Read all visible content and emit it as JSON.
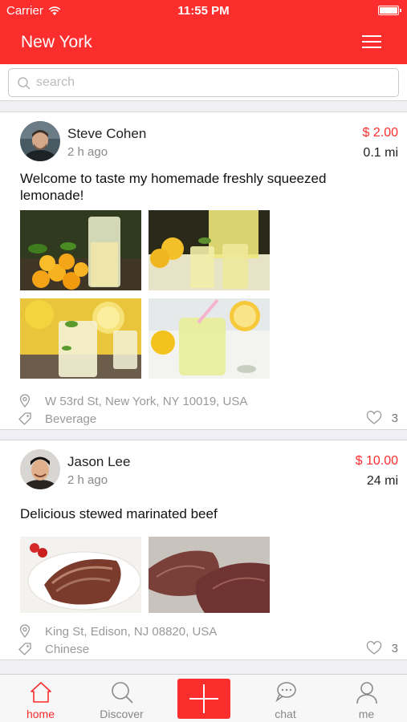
{
  "status_bar": {
    "carrier": "Carrier",
    "time": "11:55 PM"
  },
  "header": {
    "title": "New York"
  },
  "search": {
    "placeholder": "search"
  },
  "posts": [
    {
      "user": "Steve Cohen",
      "time_ago": "2 h ago",
      "price": "$ 2.00",
      "distance": "0.1 mi",
      "description": "Welcome to taste my homemade freshly squeezed lemonade!",
      "address": "W 53rd St, New York, NY 10019, USA",
      "category": "Beverage",
      "likes": "3"
    },
    {
      "user": "Jason Lee",
      "time_ago": "2 h ago",
      "price": "$ 10.00",
      "distance": "24 mi",
      "description": "Delicious stewed marinated beef",
      "address": "King St, Edison, NJ 08820, USA",
      "category": "Chinese",
      "likes": "3"
    }
  ],
  "tabbar": {
    "home": "home",
    "discover": "Discover",
    "chat": "chat",
    "me": "me"
  },
  "colors": {
    "accent": "#fb2d2d"
  }
}
